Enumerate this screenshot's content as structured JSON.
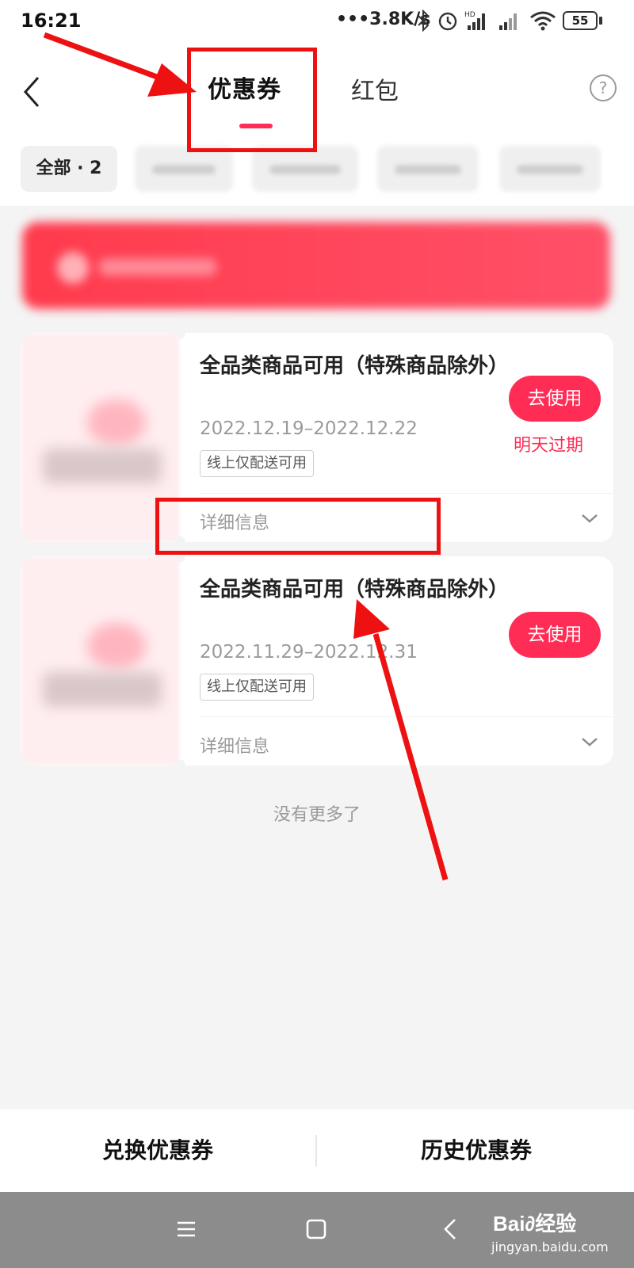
{
  "status_bar": {
    "time": "16:21",
    "network_speed": "•••3.8K/s",
    "battery": "55"
  },
  "header": {
    "tab_coupons": "优惠券",
    "tab_red_packets": "红包",
    "help_label": "?"
  },
  "filters": {
    "all_label": "全部 · 2"
  },
  "coupons": [
    {
      "title": "全品类商品可用（特殊商品除外）",
      "date_range": "2022.12.19–2022.12.22",
      "tag": "线上仅配送可用",
      "use_label": "去使用",
      "expire_note": "明天过期",
      "detail_label": "详细信息"
    },
    {
      "title": "全品类商品可用（特殊商品除外）",
      "date_range": "2022.11.29–2022.12.31",
      "tag": "线上仅配送可用",
      "use_label": "去使用",
      "detail_label": "详细信息"
    }
  ],
  "list_end_text": "没有更多了",
  "bottom_actions": {
    "redeem_label": "兑换优惠券",
    "history_label": "历史优惠券"
  },
  "nav_bar": {
    "menu_glyph": "☰",
    "home_glyph": "▢",
    "back_glyph": "‹"
  },
  "watermark": {
    "brand": "Bai∂经验",
    "url": "jingyan.baidu.com"
  },
  "colors": {
    "accent": "#ff2d55",
    "annotation": "#ee1111",
    "nav_bar_bg": "#8c8c8c"
  }
}
